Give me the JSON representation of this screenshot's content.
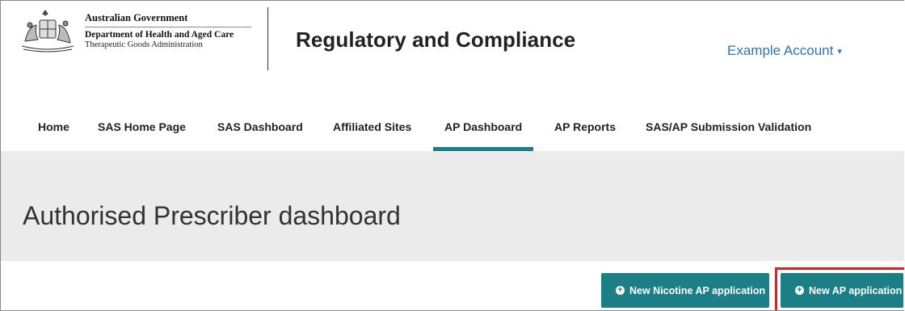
{
  "header": {
    "gov_title": "Australian Government",
    "department": "Department of Health and Aged Care",
    "agency": "Therapeutic Goods Administration",
    "app_title": "Regulatory and Compliance",
    "account_label": "Example Account",
    "account_caret": "▾"
  },
  "nav": {
    "items": [
      {
        "label": "Home"
      },
      {
        "label": "SAS Home Page"
      },
      {
        "label": "SAS Dashboard"
      },
      {
        "label": "Affiliated Sites"
      },
      {
        "label": "AP Dashboard",
        "active": true
      },
      {
        "label": "AP Reports"
      },
      {
        "label": "SAS/AP Submission Validation"
      }
    ]
  },
  "banner": {
    "title": "Authorised Prescriber dashboard"
  },
  "actions": {
    "new_nicotine_label": "New Nicotine AP application",
    "new_ap_label": "New AP application",
    "plus_glyph": "+"
  },
  "colors": {
    "teal": "#1c7f86",
    "link_blue": "#2a77b6",
    "banner_gray": "#ebebeb",
    "highlight_red": "#e0201d"
  },
  "icons": {
    "crest": "coat-of-arms-icon",
    "plus": "plus-circle-icon",
    "caret": "caret-down-icon"
  }
}
